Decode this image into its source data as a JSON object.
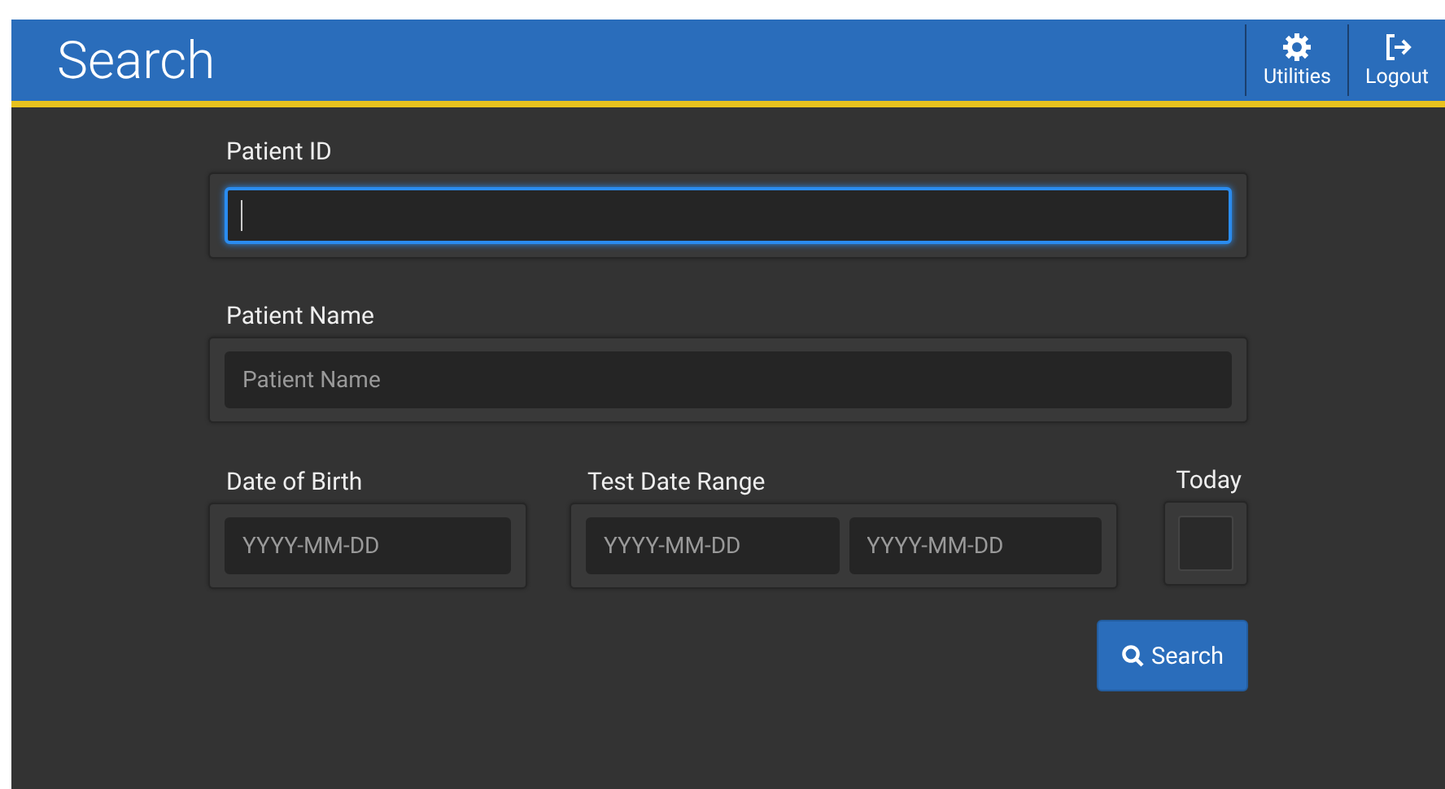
{
  "header": {
    "title": "Search",
    "actions": [
      {
        "kind": "gear",
        "label": "Utilities"
      },
      {
        "kind": "logout",
        "label": "Logout"
      }
    ]
  },
  "patient_id": {
    "label": "Patient ID",
    "focused": true
  },
  "patient_name": {
    "label": "Patient Name",
    "placeholder": "Patient Name",
    "focused": false
  },
  "date_of_birth": {
    "label": "Date of Birth",
    "placeholder": "YYYY-MM-DD"
  },
  "test_date_range": {
    "label": "Test Date Range",
    "from_placeholder": "YYYY-MM-DD",
    "to_placeholder": "YYYY-MM-DD"
  },
  "today": {
    "label": "Today",
    "checked": false
  },
  "search_button": {
    "label": "Search"
  }
}
